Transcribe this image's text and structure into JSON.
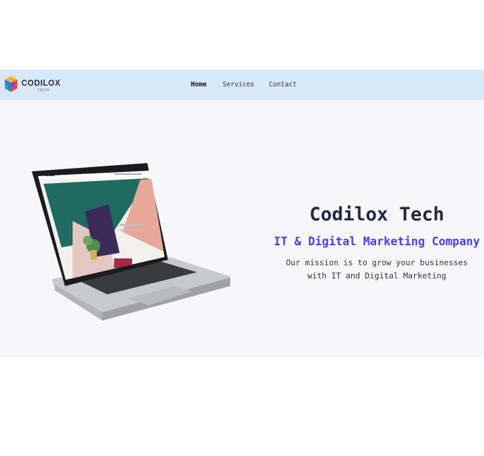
{
  "brand": {
    "name": "CODILOX",
    "tagline": "TECH",
    "colors": [
      "#3a78e0",
      "#e84a3a",
      "#f5b32a",
      "#7a3fd0",
      "#2bb3a0"
    ]
  },
  "nav": {
    "items": [
      {
        "label": "Home",
        "active": true
      },
      {
        "label": "Services",
        "active": false
      },
      {
        "label": "Contact",
        "active": false
      }
    ]
  },
  "hero": {
    "title": "Codilox Tech",
    "subtitle": "IT & Digital Marketing Company",
    "mission_line1": "Our mission is to grow your businesses",
    "mission_line2": "with IT and Digital Marketing",
    "image": "laptop-mockup",
    "colors": {
      "title": "#262641",
      "subtitle": "#4a40e0"
    }
  }
}
